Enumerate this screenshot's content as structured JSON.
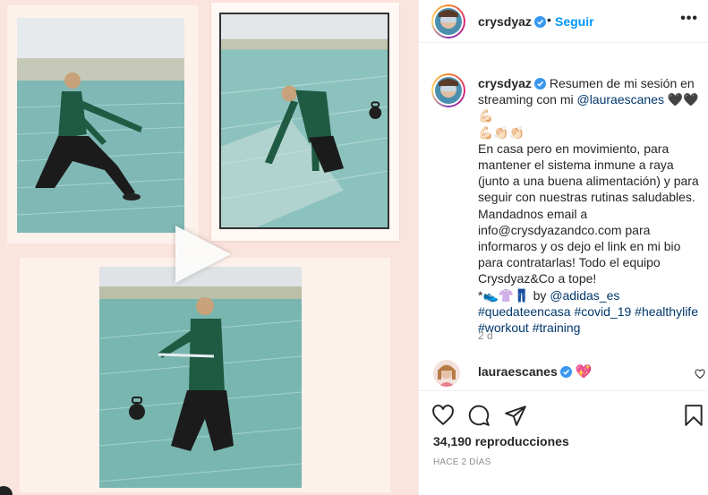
{
  "post": {
    "author": "crysdyaz",
    "follow_sep": "•",
    "follow_label": "Seguir",
    "more_label": "•••"
  },
  "caption": {
    "author": "crysdyaz",
    "text_1": "Resumen de mi sesión en streaming con mi ",
    "mention_1": "@lauraescanes",
    "text_2": " 🖤🖤💪🏻",
    "text_3": "💪🏻👏🏻👏🏻",
    "text_4": "En casa pero en movimiento, para mantener el sistema inmune a raya (junto a una buena alimentación) y para seguir con nuestras rutinas saludables. Mandadnos email a info@crysdyazandco.com para informaros y os dejo el link en mi bio para contratarlas! Todo el equipo Crysdyaz&Co a tope!",
    "text_5": "*👟👚👖 by ",
    "mention_2": "@adidas_es",
    "tag_1": "#quedateencasa",
    "tag_2": "#covid_19",
    "tag_3": "#healthylife",
    "tag_4": "#workout",
    "tag_5": "#training",
    "time": "2 d"
  },
  "comment": {
    "author": "lauraescanes",
    "emoji": "💖"
  },
  "stats": {
    "views": "34,190 reproducciones",
    "posted": "HACE 2 DÍAS"
  },
  "icons": {
    "like": "heart-icon",
    "comment": "comment-icon",
    "share": "share-icon",
    "save": "bookmark-icon",
    "play": "play-icon",
    "more": "more-icon",
    "verified": "verified-badge-icon"
  },
  "colors": {
    "follow": "#0095f6",
    "link": "#00376b",
    "verified": "#3897f0",
    "media_bg": "#fbe4dd"
  }
}
